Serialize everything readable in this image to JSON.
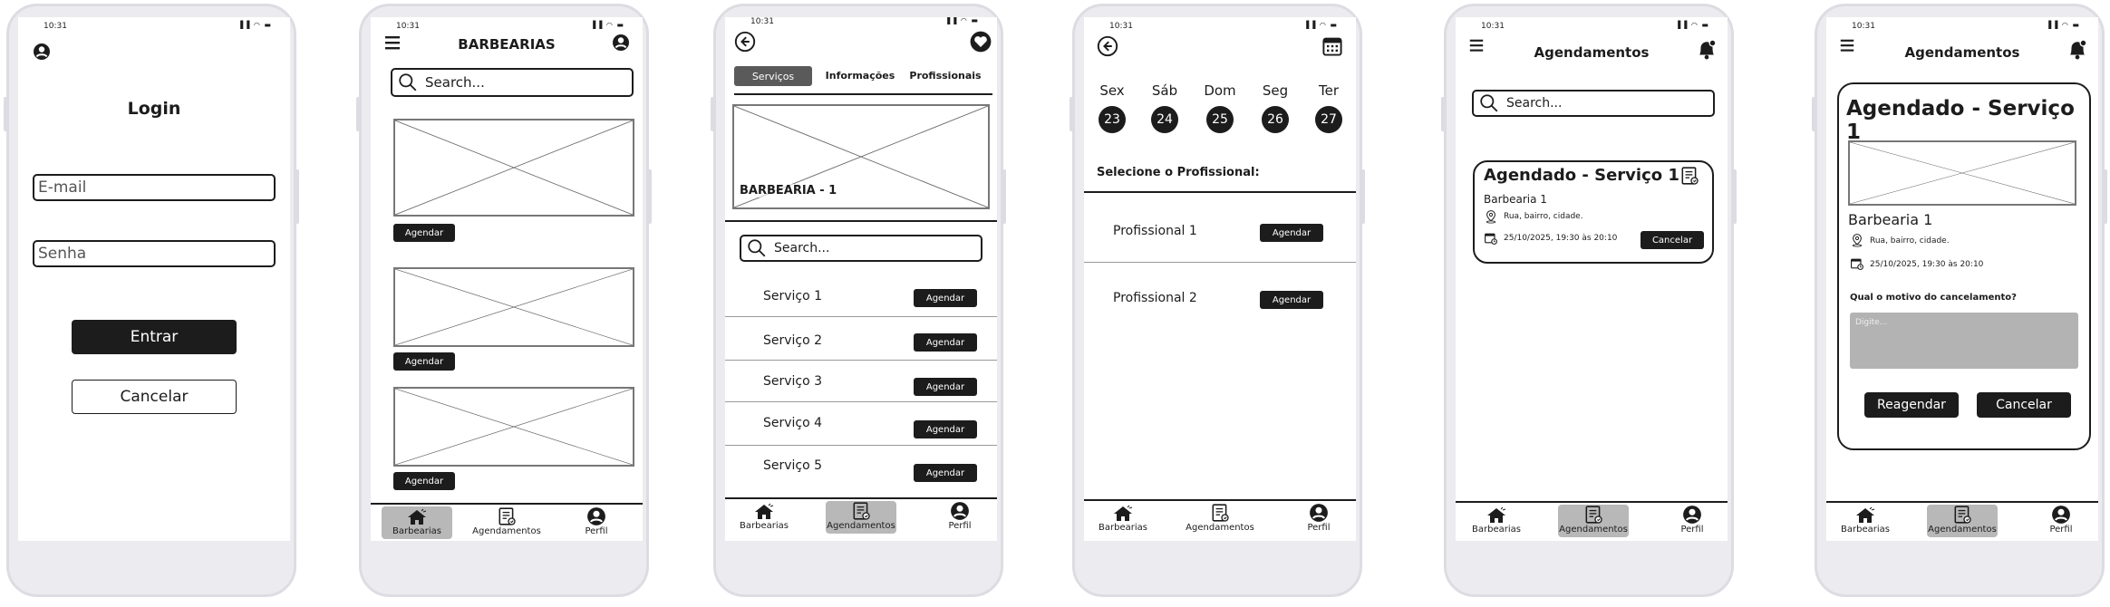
{
  "status_time": "10:31",
  "status_icons": "▐▐ ◠ ▬",
  "login": {
    "title": "Login",
    "email_placeholder": "E-mail",
    "password_placeholder": "Senha",
    "submit_label": "Entrar",
    "cancel_label": "Cancelar"
  },
  "barbearias": {
    "title": "BARBEARIAS",
    "search_placeholder": "Search...",
    "agendar_label": "Agendar"
  },
  "barbearia_detail": {
    "tabs": [
      "Serviços",
      "Informações",
      "Profissionais"
    ],
    "banner_label": "BARBEARIA - 1",
    "search_placeholder": "Search...",
    "services": [
      "Serviço 1",
      "Serviço 2",
      "Serviço 3",
      "Serviço 4",
      "Serviço 5"
    ],
    "agendar_label": "Agendar"
  },
  "schedule": {
    "days": [
      {
        "label": "Sex",
        "num": "23"
      },
      {
        "label": "Sáb",
        "num": "24"
      },
      {
        "label": "Dom",
        "num": "25"
      },
      {
        "label": "Seg",
        "num": "26"
      },
      {
        "label": "Ter",
        "num": "27"
      }
    ],
    "select_label": "Selecione o Profissional:",
    "professionals": [
      "Profissional 1",
      "Profissional 2"
    ],
    "agendar_label": "Agendar"
  },
  "agendamentos": {
    "title": "Agendamentos",
    "search_placeholder": "Search...",
    "card_title": "Agendado - Serviço 1",
    "card_shop": "Barbearia 1",
    "card_address": "Rua, bairro, cidade.",
    "card_datetime": "25/10/2025, 19:30 às 20:10",
    "cancel_label": "Cancelar"
  },
  "cancel_screen": {
    "title": "Agendamentos",
    "card_title": "Agendado - Serviço 1",
    "shop": "Barbearia 1",
    "address": "Rua, bairro, cidade.",
    "datetime": "25/10/2025, 19:30 às 20:10",
    "reason_label": "Qual o motivo do cancelamento?",
    "reason_placeholder": "Digite...",
    "reschedule_label": "Reagendar",
    "cancel_label": "Cancelar"
  },
  "nav": {
    "home": "Barbearias",
    "appointments": "Agendamentos",
    "profile": "Perfil"
  },
  "colors": {
    "dark": "#1c1c1c",
    "active_nav": "#b8b8b8",
    "textarea": "#b3b3b3"
  }
}
